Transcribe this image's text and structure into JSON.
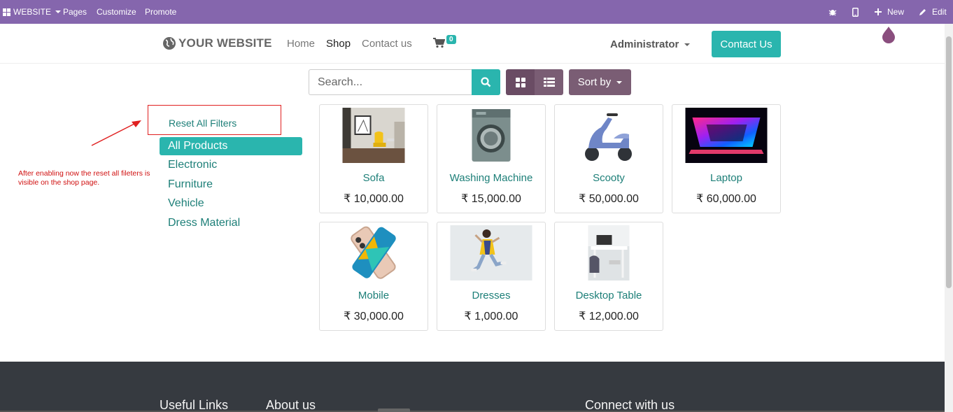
{
  "adminbar": {
    "website_menu": "WEBSITE",
    "pages": "Pages",
    "customize": "Customize",
    "promote": "Promote",
    "new": "New",
    "edit": "Edit"
  },
  "header": {
    "logo": "YOUR WEBSITE",
    "nav": [
      "Home",
      "Shop",
      "Contact us"
    ],
    "active_nav": "Shop",
    "cart_count": "0",
    "user": "Administrator",
    "cta": "Contact Us"
  },
  "search": {
    "placeholder": "Search..."
  },
  "sort": {
    "label": "Sort by"
  },
  "filters": {
    "reset": "Reset All Filters",
    "categories": [
      "All Products",
      "Electronic",
      "Furniture",
      "Vehicle",
      "Dress Material"
    ],
    "active": "All Products"
  },
  "annotation": {
    "text": "After enabling now the reset all fileters is visible on the shop page."
  },
  "products": [
    {
      "name": "Sofa",
      "price": "₹ 10,000.00",
      "icon": "sofa-image"
    },
    {
      "name": "Washing Machine",
      "price": "₹ 15,000.00",
      "icon": "washing-machine-image"
    },
    {
      "name": "Scooty",
      "price": "₹ 50,000.00",
      "icon": "scooter-image"
    },
    {
      "name": "Laptop",
      "price": "₹ 60,000.00",
      "icon": "laptop-image"
    },
    {
      "name": "Mobile",
      "price": "₹ 30,000.00",
      "icon": "mobile-image"
    },
    {
      "name": "Dresses",
      "price": "₹ 1,000.00",
      "icon": "dress-image"
    },
    {
      "name": "Desktop Table",
      "price": "₹ 12,000.00",
      "icon": "desk-image"
    }
  ],
  "footer": {
    "col1": "Useful Links",
    "col2": "About us",
    "col3": "Connect with us"
  },
  "colors": {
    "admin_bar": "#8566ad",
    "accent": "#2ab5ae",
    "secondary": "#7a5d74",
    "link": "#1d7f78",
    "annotation": "#e02020",
    "footer": "#363a40"
  }
}
